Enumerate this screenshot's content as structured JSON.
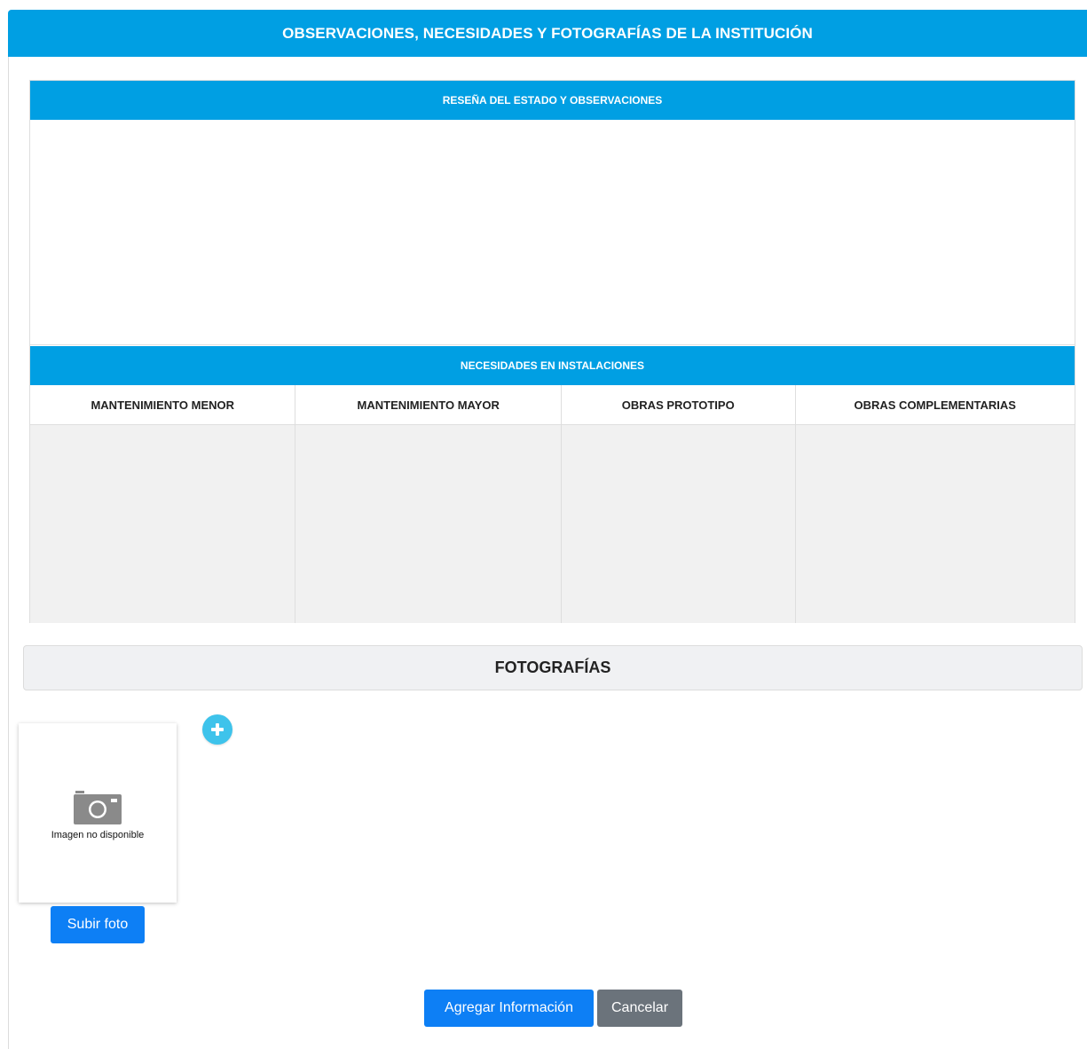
{
  "header": {
    "title": "OBSERVACIONES, NECESIDADES Y FOTOGRAFÍAS DE LA INSTITUCIÓN"
  },
  "resena": {
    "title": "RESEÑA DEL ESTADO Y OBSERVACIONES",
    "value": ""
  },
  "necesidades": {
    "title": "NECESIDADES EN INSTALACIONES",
    "columns": [
      {
        "label": "MANTENIMIENTO MENOR",
        "value": ""
      },
      {
        "label": "MANTENIMIENTO MAYOR",
        "value": ""
      },
      {
        "label": "OBRAS PROTOTIPO",
        "value": ""
      },
      {
        "label": "OBRAS COMPLEMENTARIAS",
        "value": ""
      }
    ]
  },
  "fotografias": {
    "title": "FOTOGRAFÍAS",
    "placeholder_caption": "Imagen no disponible",
    "upload_label": "Subir foto",
    "add_icon": "plus-circle-icon",
    "placeholder_icon": "camera-icon"
  },
  "actions": {
    "submit_label": "Agregar Información",
    "cancel_label": "Cancelar"
  },
  "colors": {
    "primary": "#009fe3",
    "button_primary": "#0d7ff5",
    "button_secondary": "#6b737b",
    "add_button": "#3ec3eb"
  }
}
